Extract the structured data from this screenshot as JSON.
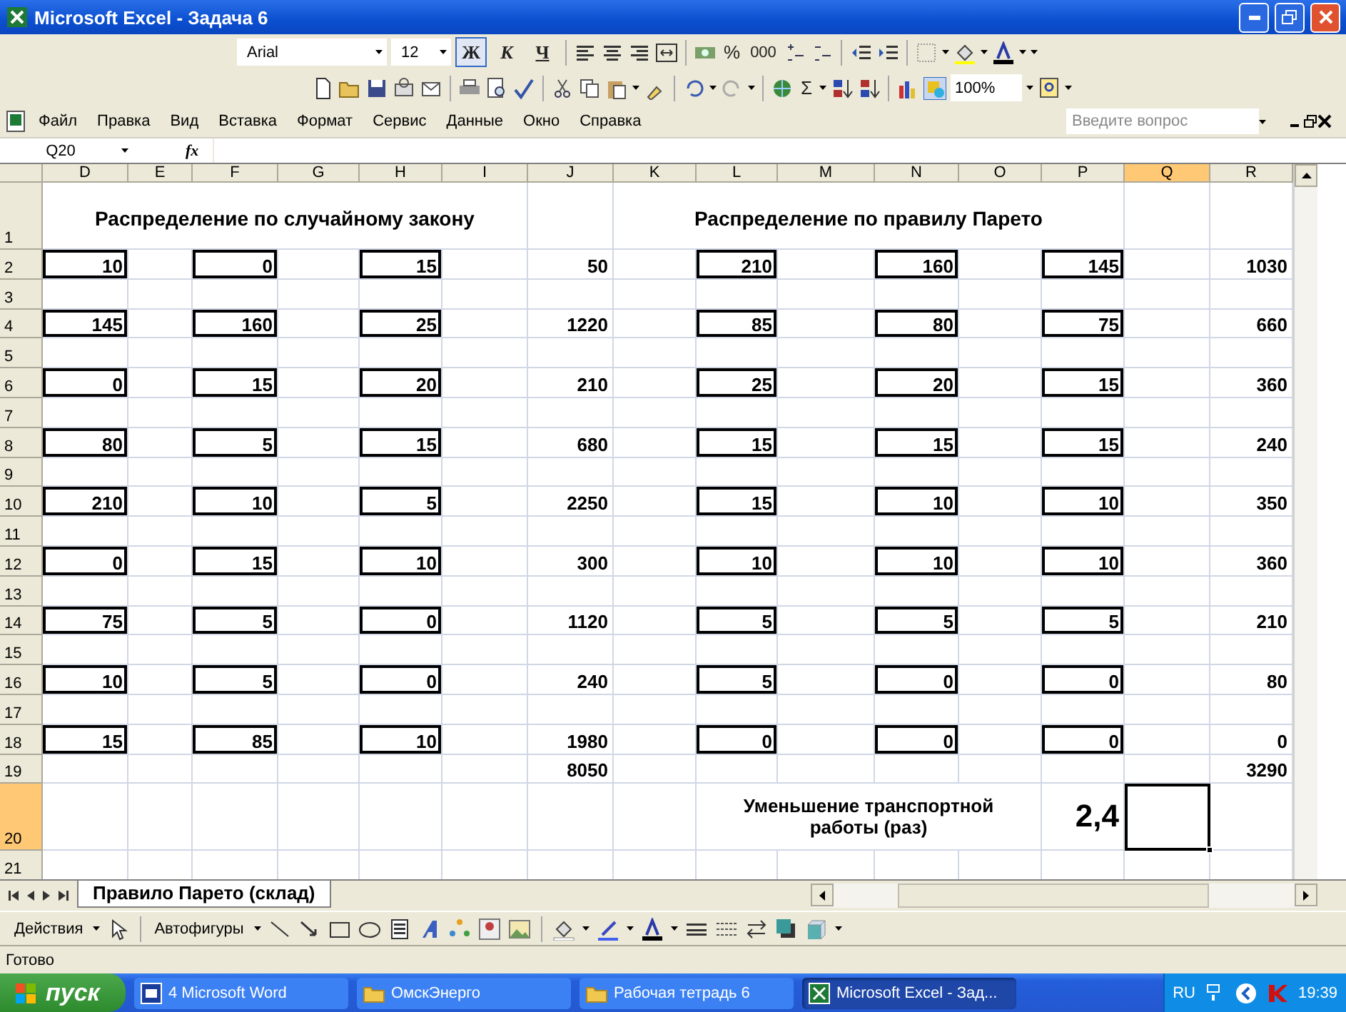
{
  "window": {
    "title": "Microsoft Excel - Задача 6"
  },
  "formatting_toolbar": {
    "font": "Arial",
    "size": "12",
    "styles": [
      {
        "label": "Ж",
        "selected": true
      },
      {
        "label": "К",
        "selected": false
      },
      {
        "label": "Ч",
        "selected": false
      }
    ],
    "percent": "%",
    "thousands": "000"
  },
  "standard_toolbar": {
    "sum": "Σ",
    "zoom": "100%"
  },
  "menu": [
    "Файл",
    "Правка",
    "Вид",
    "Вставка",
    "Формат",
    "Сервис",
    "Данные",
    "Окно",
    "Справка"
  ],
  "help_search": {
    "placeholder": "Введите вопрос"
  },
  "formula_bar": {
    "name_box": "Q20",
    "fx": "fx"
  },
  "sheet": {
    "columns": [
      {
        "label": "D",
        "selected": false
      },
      {
        "label": "E",
        "selected": false
      },
      {
        "label": "F",
        "selected": false
      },
      {
        "label": "G",
        "selected": false
      },
      {
        "label": "H",
        "selected": false
      },
      {
        "label": "I",
        "selected": false
      },
      {
        "label": "J",
        "selected": false
      },
      {
        "label": "K",
        "selected": false
      },
      {
        "label": "L",
        "selected": false
      },
      {
        "label": "M",
        "selected": false
      },
      {
        "label": "N",
        "selected": false
      },
      {
        "label": "O",
        "selected": false
      },
      {
        "label": "P",
        "selected": false
      },
      {
        "label": "Q",
        "selected": true
      },
      {
        "label": "R",
        "selected": false
      }
    ],
    "rows": [
      {
        "number": "1",
        "selected": false,
        "tall": true,
        "cells": [
          {
            "kind": "heading",
            "text": "Распределение по случайному закону"
          },
          {
            "merged": true
          },
          {
            "merged": true
          },
          {
            "merged": true
          },
          {
            "merged": true
          },
          {
            "merged": true
          },
          null,
          {
            "kind": "heading",
            "text": "Распределение по правилу Парето"
          },
          {
            "merged": true
          },
          {
            "merged": true
          },
          {
            "merged": true
          },
          {
            "merged": true
          },
          {
            "merged": true
          },
          null,
          null
        ]
      },
      {
        "number": "2",
        "selected": false,
        "tall": false,
        "cells": [
          {
            "kind": "number",
            "text": "10",
            "boxed": true
          },
          null,
          {
            "kind": "number",
            "text": "0",
            "boxed": true
          },
          null,
          {
            "kind": "number",
            "text": "15",
            "boxed": true
          },
          null,
          {
            "kind": "number",
            "text": "50",
            "boxed": false
          },
          null,
          {
            "kind": "number",
            "text": "210",
            "boxed": true
          },
          null,
          {
            "kind": "number",
            "text": "160",
            "boxed": true
          },
          null,
          {
            "kind": "number",
            "text": "145",
            "boxed": true
          },
          null,
          {
            "kind": "number",
            "text": "1030",
            "boxed": false
          }
        ]
      },
      {
        "number": "3",
        "selected": false,
        "tall": false
      },
      {
        "number": "4",
        "selected": false,
        "tall": false,
        "cells": [
          {
            "kind": "number",
            "text": "145",
            "boxed": true
          },
          null,
          {
            "kind": "number",
            "text": "160",
            "boxed": true
          },
          null,
          {
            "kind": "number",
            "text": "25",
            "boxed": true
          },
          null,
          {
            "kind": "number",
            "text": "1220",
            "boxed": false
          },
          null,
          {
            "kind": "number",
            "text": "85",
            "boxed": true
          },
          null,
          {
            "kind": "number",
            "text": "80",
            "boxed": true
          },
          null,
          {
            "kind": "number",
            "text": "75",
            "boxed": true
          },
          null,
          {
            "kind": "number",
            "text": "660",
            "boxed": false
          }
        ]
      },
      {
        "number": "5",
        "selected": false,
        "tall": false
      },
      {
        "number": "6",
        "selected": false,
        "tall": false,
        "cells": [
          {
            "kind": "number",
            "text": "0",
            "boxed": true
          },
          null,
          {
            "kind": "number",
            "text": "15",
            "boxed": true
          },
          null,
          {
            "kind": "number",
            "text": "20",
            "boxed": true
          },
          null,
          {
            "kind": "number",
            "text": "210",
            "boxed": false
          },
          null,
          {
            "kind": "number",
            "text": "25",
            "boxed": true
          },
          null,
          {
            "kind": "number",
            "text": "20",
            "boxed": true
          },
          null,
          {
            "kind": "number",
            "text": "15",
            "boxed": true
          },
          null,
          {
            "kind": "number",
            "text": "360",
            "boxed": false
          }
        ]
      },
      {
        "number": "7",
        "selected": false,
        "tall": false
      },
      {
        "number": "8",
        "selected": false,
        "tall": false,
        "cells": [
          {
            "kind": "number",
            "text": "80",
            "boxed": true
          },
          null,
          {
            "kind": "number",
            "text": "5",
            "boxed": true
          },
          null,
          {
            "kind": "number",
            "text": "15",
            "boxed": true
          },
          null,
          {
            "kind": "number",
            "text": "680",
            "boxed": false
          },
          null,
          {
            "kind": "number",
            "text": "15",
            "boxed": true
          },
          null,
          {
            "kind": "number",
            "text": "15",
            "boxed": true
          },
          null,
          {
            "kind": "number",
            "text": "15",
            "boxed": true
          },
          null,
          {
            "kind": "number",
            "text": "240",
            "boxed": false
          }
        ]
      },
      {
        "number": "9",
        "selected": false,
        "tall": false
      },
      {
        "number": "10",
        "selected": false,
        "tall": false,
        "cells": [
          {
            "kind": "number",
            "text": "210",
            "boxed": true
          },
          null,
          {
            "kind": "number",
            "text": "10",
            "boxed": true
          },
          null,
          {
            "kind": "number",
            "text": "5",
            "boxed": true
          },
          null,
          {
            "kind": "number",
            "text": "2250",
            "boxed": false
          },
          null,
          {
            "kind": "number",
            "text": "15",
            "boxed": true
          },
          null,
          {
            "kind": "number",
            "text": "10",
            "boxed": true
          },
          null,
          {
            "kind": "number",
            "text": "10",
            "boxed": true
          },
          null,
          {
            "kind": "number",
            "text": "350",
            "boxed": false
          }
        ]
      },
      {
        "number": "11",
        "selected": false,
        "tall": false
      },
      {
        "number": "12",
        "selected": false,
        "tall": false,
        "cells": [
          {
            "kind": "number",
            "text": "0",
            "boxed": true
          },
          null,
          {
            "kind": "number",
            "text": "15",
            "boxed": true
          },
          null,
          {
            "kind": "number",
            "text": "10",
            "boxed": true
          },
          null,
          {
            "kind": "number",
            "text": "300",
            "boxed": false
          },
          null,
          {
            "kind": "number",
            "text": "10",
            "boxed": true
          },
          null,
          {
            "kind": "number",
            "text": "10",
            "boxed": true
          },
          null,
          {
            "kind": "number",
            "text": "10",
            "boxed": true
          },
          null,
          {
            "kind": "number",
            "text": "360",
            "boxed": false
          }
        ]
      },
      {
        "number": "13",
        "selected": false,
        "tall": false
      },
      {
        "number": "14",
        "selected": false,
        "tall": false,
        "cells": [
          {
            "kind": "number",
            "text": "75",
            "boxed": true
          },
          null,
          {
            "kind": "number",
            "text": "5",
            "boxed": true
          },
          null,
          {
            "kind": "number",
            "text": "0",
            "boxed": true
          },
          null,
          {
            "kind": "number",
            "text": "1120",
            "boxed": false
          },
          null,
          {
            "kind": "number",
            "text": "5",
            "boxed": true
          },
          null,
          {
            "kind": "number",
            "text": "5",
            "boxed": true
          },
          null,
          {
            "kind": "number",
            "text": "5",
            "boxed": true
          },
          null,
          {
            "kind": "number",
            "text": "210",
            "boxed": false
          }
        ]
      },
      {
        "number": "15",
        "selected": false,
        "tall": false
      },
      {
        "number": "16",
        "selected": false,
        "tall": false,
        "cells": [
          {
            "kind": "number",
            "text": "10",
            "boxed": true
          },
          null,
          {
            "kind": "number",
            "text": "5",
            "boxed": true
          },
          null,
          {
            "kind": "number",
            "text": "0",
            "boxed": true
          },
          null,
          {
            "kind": "number",
            "text": "240",
            "boxed": false
          },
          null,
          {
            "kind": "number",
            "text": "5",
            "boxed": true
          },
          null,
          {
            "kind": "number",
            "text": "0",
            "boxed": true
          },
          null,
          {
            "kind": "number",
            "text": "0",
            "boxed": true
          },
          null,
          {
            "kind": "number",
            "text": "80",
            "boxed": false
          }
        ]
      },
      {
        "number": "17",
        "selected": false,
        "tall": false
      },
      {
        "number": "18",
        "selected": false,
        "tall": false,
        "cells": [
          {
            "kind": "number",
            "text": "15",
            "boxed": true
          },
          null,
          {
            "kind": "number",
            "text": "85",
            "boxed": true
          },
          null,
          {
            "kind": "number",
            "text": "10",
            "boxed": true
          },
          null,
          {
            "kind": "number",
            "text": "1980",
            "boxed": false
          },
          null,
          {
            "kind": "number",
            "text": "0",
            "boxed": true
          },
          null,
          {
            "kind": "number",
            "text": "0",
            "boxed": true
          },
          null,
          {
            "kind": "number",
            "text": "0",
            "boxed": true
          },
          null,
          {
            "kind": "number",
            "text": "0",
            "boxed": false
          }
        ]
      },
      {
        "number": "19",
        "selected": false,
        "tall": false,
        "cells": [
          null,
          null,
          null,
          null,
          null,
          null,
          {
            "kind": "number",
            "text": "8050",
            "boxed": false
          },
          null,
          null,
          null,
          null,
          null,
          null,
          null,
          {
            "kind": "number",
            "text": "3290",
            "boxed": false
          }
        ]
      },
      {
        "number": "20",
        "selected": true,
        "tall": true,
        "cells": [
          null,
          null,
          null,
          null,
          null,
          null,
          null,
          null,
          {
            "kind": "note",
            "text": "Уменьшение транспортной работы (раз)"
          },
          {
            "merged": true
          },
          {
            "merged": true
          },
          {
            "merged": true
          },
          {
            "kind": "big",
            "text": "2,4"
          },
          null,
          null
        ]
      },
      {
        "number": "21",
        "selected": false,
        "tall": false
      }
    ]
  },
  "sheet_tabs": [
    {
      "label": "Правило Парето (склад)",
      "selected": true
    }
  ],
  "drawing_toolbar": {
    "actions": "Действия",
    "autoshapes": "Автофигуры"
  },
  "status_bar": "Готово",
  "taskbar": {
    "start": "пуск",
    "buttons": [
      {
        "label": "4 Microsoft Word",
        "kind": "word",
        "selected": false
      },
      {
        "label": "ОмскЭнерго",
        "kind": "folder",
        "selected": false
      },
      {
        "label": "Рабочая тетрадь 6",
        "kind": "folder",
        "selected": false
      },
      {
        "label": "Microsoft Excel - Зад...",
        "kind": "excel",
        "selected": true
      }
    ],
    "language": "RU",
    "clock": "19:39"
  }
}
